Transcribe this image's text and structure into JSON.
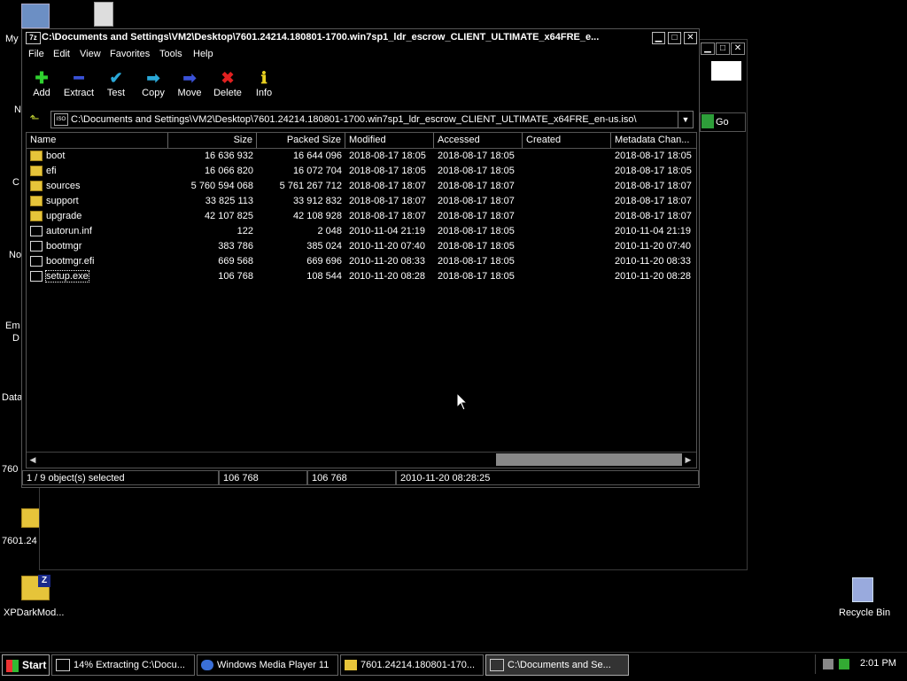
{
  "desktop": {
    "icons": [
      {
        "label": "My",
        "icon": "my-computer-icon"
      },
      {
        "label": "N",
        "icon": "network-icon"
      },
      {
        "label": "C",
        "icon": "shortcut-icon"
      },
      {
        "label": "No",
        "icon": "notepad-icon"
      },
      {
        "label": "Em",
        "icon": "email-icon"
      },
      {
        "label": "D",
        "icon": "doc-icon"
      },
      {
        "label": "Data",
        "icon": "data-icon"
      },
      {
        "label": "760",
        "icon": "folder-icon"
      },
      {
        "label": "7601.24",
        "icon": "folder-icon"
      },
      {
        "label": "XPDarkMod...",
        "icon": "zip-folder-icon"
      },
      {
        "label": "Recycle Bin",
        "icon": "recycle-bin-icon"
      }
    ],
    "bg_window": {
      "go_label": "Go"
    }
  },
  "window": {
    "title": "C:\\Documents and Settings\\VM2\\Desktop\\7601.24214.180801-1700.win7sp1_ldr_escrow_CLIENT_ULTIMATE_x64FRE_e...",
    "app_icon_text": "7z",
    "menu": [
      "File",
      "Edit",
      "View",
      "Favorites",
      "Tools",
      "Help"
    ],
    "toolbar": [
      {
        "label": "Add",
        "icon": "plus-icon",
        "color": "#2fd12f",
        "glyph": "✚"
      },
      {
        "label": "Extract",
        "icon": "minus-icon",
        "color": "#3a52d8",
        "glyph": "━"
      },
      {
        "label": "Test",
        "icon": "checkmark-icon",
        "color": "#2aa8d8",
        "glyph": "✔"
      },
      {
        "label": "Copy",
        "icon": "copy-arrow-icon",
        "color": "#2aa8d8",
        "glyph": "➡"
      },
      {
        "label": "Move",
        "icon": "move-arrow-icon",
        "color": "#3a52d8",
        "glyph": "➡"
      },
      {
        "label": "Delete",
        "icon": "delete-x-icon",
        "color": "#e02020",
        "glyph": "✖"
      },
      {
        "label": "Info",
        "icon": "info-icon",
        "color": "#e8d020",
        "glyph": "ℹ"
      }
    ],
    "address": "C:\\Documents and Settings\\VM2\\Desktop\\7601.24214.180801-1700.win7sp1_ldr_escrow_CLIENT_ULTIMATE_x64FRE_en-us.iso\\",
    "columns": [
      "Name",
      "Size",
      "Packed Size",
      "Modified",
      "Accessed",
      "Created",
      "Metadata Chan..."
    ],
    "rows": [
      {
        "type": "folder",
        "name": "boot",
        "size": "16 636 932",
        "packed": "16 644 096",
        "modified": "2018-08-17 18:05",
        "accessed": "2018-08-17 18:05",
        "created": "",
        "meta": "2018-08-17 18:05"
      },
      {
        "type": "folder",
        "name": "efi",
        "size": "16 066 820",
        "packed": "16 072 704",
        "modified": "2018-08-17 18:05",
        "accessed": "2018-08-17 18:05",
        "created": "",
        "meta": "2018-08-17 18:05"
      },
      {
        "type": "folder",
        "name": "sources",
        "size": "5 760 594 068",
        "packed": "5 761 267 712",
        "modified": "2018-08-17 18:07",
        "accessed": "2018-08-17 18:07",
        "created": "",
        "meta": "2018-08-17 18:07"
      },
      {
        "type": "folder",
        "name": "support",
        "size": "33 825 113",
        "packed": "33 912 832",
        "modified": "2018-08-17 18:07",
        "accessed": "2018-08-17 18:07",
        "created": "",
        "meta": "2018-08-17 18:07"
      },
      {
        "type": "folder",
        "name": "upgrade",
        "size": "42 107 825",
        "packed": "42 108 928",
        "modified": "2018-08-17 18:07",
        "accessed": "2018-08-17 18:07",
        "created": "",
        "meta": "2018-08-17 18:07"
      },
      {
        "type": "file",
        "name": "autorun.inf",
        "size": "122",
        "packed": "2 048",
        "modified": "2010-11-04 21:19",
        "accessed": "2018-08-17 18:05",
        "created": "",
        "meta": "2010-11-04 21:19"
      },
      {
        "type": "file",
        "name": "bootmgr",
        "size": "383 786",
        "packed": "385 024",
        "modified": "2010-11-20 07:40",
        "accessed": "2018-08-17 18:05",
        "created": "",
        "meta": "2010-11-20 07:40"
      },
      {
        "type": "file",
        "name": "bootmgr.efi",
        "size": "669 568",
        "packed": "669 696",
        "modified": "2010-11-20 08:33",
        "accessed": "2018-08-17 18:05",
        "created": "",
        "meta": "2010-11-20 08:33"
      },
      {
        "type": "file",
        "name": "setup.exe",
        "size": "106 768",
        "packed": "108 544",
        "modified": "2010-11-20 08:28",
        "accessed": "2018-08-17 18:05",
        "created": "",
        "meta": "2010-11-20 08:28",
        "selected": true
      }
    ],
    "status": {
      "selection": "1 / 9 object(s) selected",
      "size": "106 768",
      "packed": "106 768",
      "modified": "2010-11-20 08:28:25"
    }
  },
  "taskbar": {
    "start_label": "Start",
    "tasks": [
      {
        "label": "14% Extracting C:\\Docu...",
        "active": false
      },
      {
        "label": "Windows Media Player 11",
        "active": false
      },
      {
        "label": "7601.24214.180801-170...",
        "active": false
      },
      {
        "label": "C:\\Documents and Se...",
        "active": true
      }
    ],
    "clock": "2:01 PM"
  }
}
